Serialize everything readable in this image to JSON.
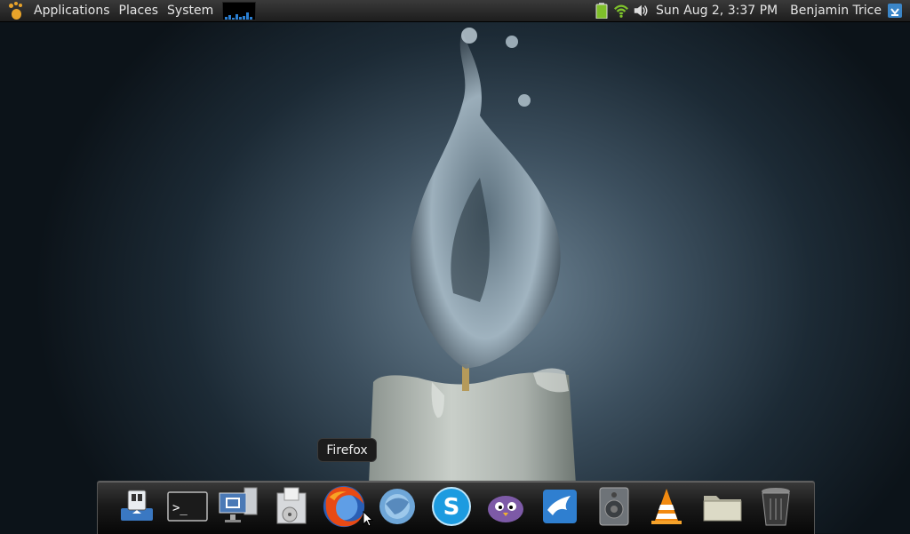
{
  "top_panel": {
    "menus": [
      "Applications",
      "Places",
      "System"
    ],
    "clock": "Sun Aug  2,  3:37 PM",
    "user": "Benjamin Trice",
    "tray_icons": [
      "battery-icon",
      "wifi-icon",
      "volume-icon"
    ],
    "user_icon": "shutdown-icon"
  },
  "dock": {
    "items": [
      {
        "name": "thunar-icon"
      },
      {
        "name": "terminal-icon"
      },
      {
        "name": "network-manager-icon"
      },
      {
        "name": "gdebi-icon"
      },
      {
        "name": "firefox-icon"
      },
      {
        "name": "thunderbird-icon"
      },
      {
        "name": "skype-icon"
      },
      {
        "name": "pidgin-icon"
      },
      {
        "name": "mail-icon"
      },
      {
        "name": "speaker-icon"
      },
      {
        "name": "vlc-icon"
      },
      {
        "name": "folder-icon"
      },
      {
        "name": "trash-icon"
      }
    ],
    "tooltip": "Firefox"
  },
  "colors": {
    "panel_text": "#e6e6e6",
    "accent_orange": "#e8a32a"
  }
}
